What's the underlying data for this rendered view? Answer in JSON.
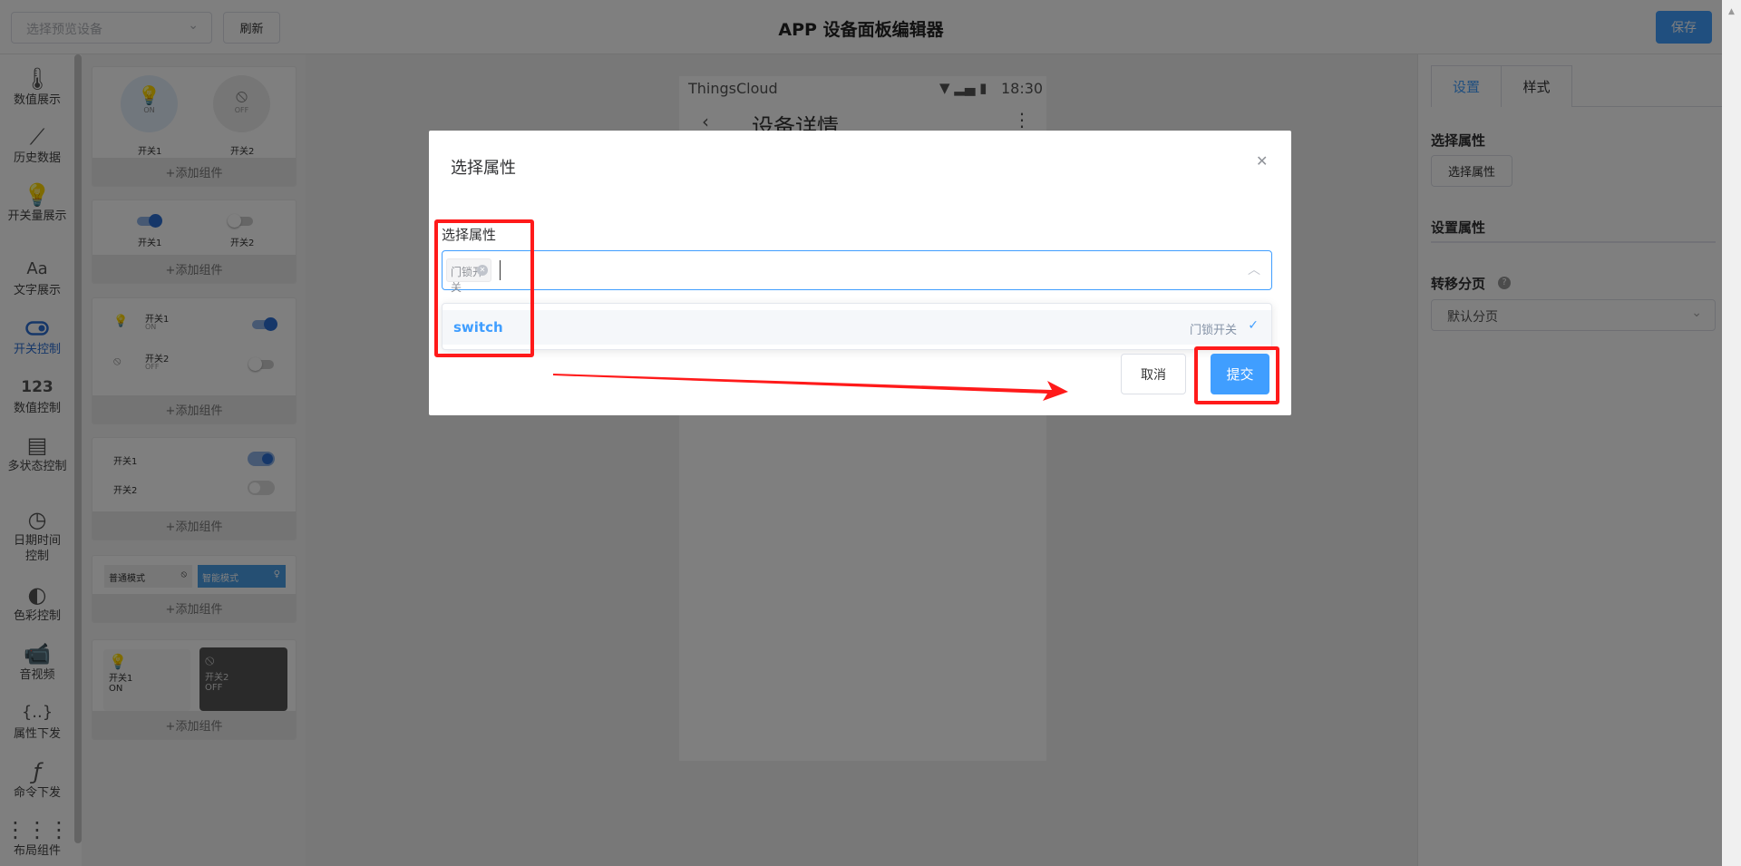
{
  "header": {
    "device_select_placeholder": "选择预览设备",
    "refresh_label": "刷新",
    "title": "APP 设备面板编辑器",
    "save_label": "保存"
  },
  "sidebar": {
    "items": [
      {
        "label": "数值展示",
        "icon": "thermometer-icon"
      },
      {
        "label": "历史数据",
        "icon": "line-chart-icon"
      },
      {
        "label": "开关量展示",
        "icon": "bulb-icon"
      },
      {
        "label": "文字展示",
        "icon": "text-icon"
      },
      {
        "label": "开关控制",
        "icon": "toggle-icon",
        "active": true
      },
      {
        "label": "数值控制",
        "icon": "number-icon"
      },
      {
        "label": "多状态控制",
        "icon": "list-icon"
      },
      {
        "label": "日期时间控制",
        "icon": "timer-icon"
      },
      {
        "label": "色彩控制",
        "icon": "color-drop-icon"
      },
      {
        "label": "音视频",
        "icon": "camera-icon"
      },
      {
        "label": "属性下发",
        "icon": "braces-icon"
      },
      {
        "label": "命令下发",
        "icon": "function-icon"
      },
      {
        "label": "布局组件",
        "icon": "grid-icon"
      }
    ]
  },
  "components": {
    "add_label": "+添加组件",
    "switch1": "开关1",
    "switch2": "开关2",
    "on": "ON",
    "off": "OFF",
    "mode_normal": "普通模式",
    "mode_smart": "智能模式"
  },
  "phone": {
    "app_name": "ThingsCloud",
    "time": "18:30",
    "page_title": "设备详情"
  },
  "right_panel": {
    "tabs": [
      "设置",
      "样式"
    ],
    "select_prop_heading": "选择属性",
    "select_prop_button": "选择属性",
    "set_prop_heading": "设置属性",
    "transfer_page_label": "转移分页",
    "transfer_page_value": "默认分页"
  },
  "dialog": {
    "title": "选择属性",
    "field_label": "选择属性",
    "selected_tag": "门锁开关",
    "options": [
      {
        "key": "switch",
        "name": "门锁开关",
        "selected": true
      }
    ],
    "cancel_label": "取消",
    "submit_label": "提交"
  },
  "colors": {
    "accent": "#409eff",
    "annotation": "#ff1a1a",
    "active_nav": "#2d6fd3"
  }
}
